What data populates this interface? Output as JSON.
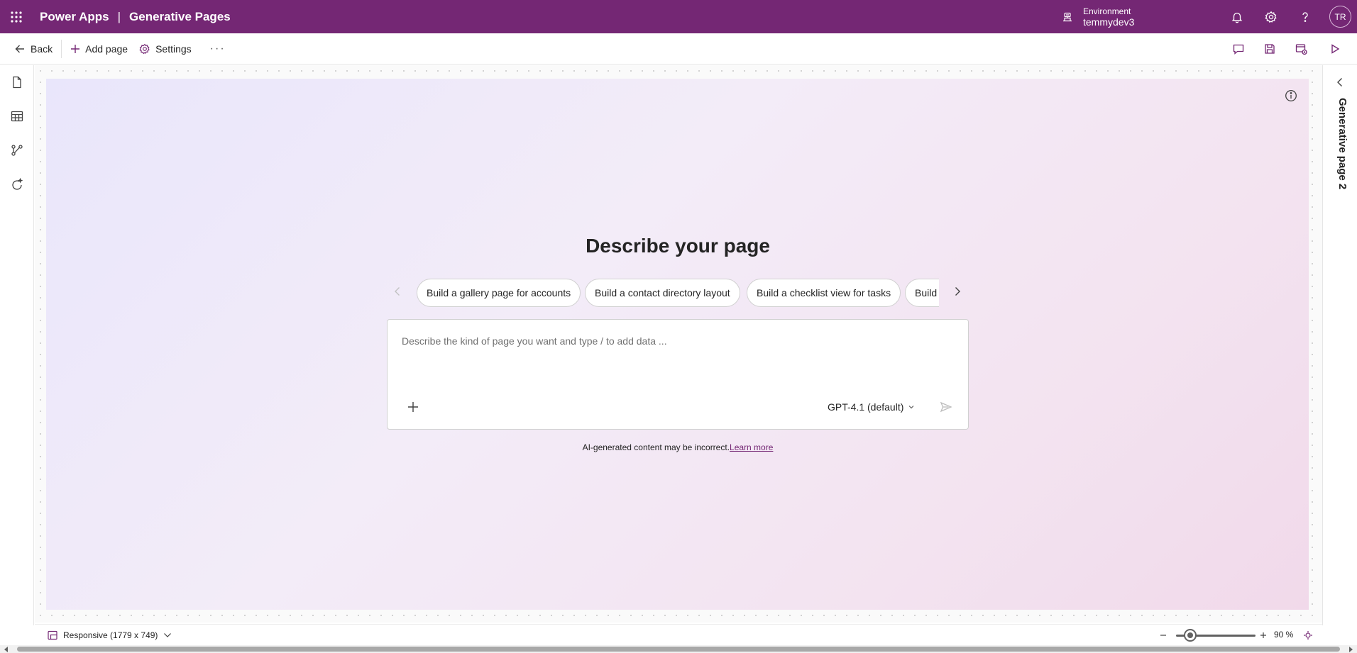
{
  "header": {
    "app_name": "Power Apps",
    "separator": "|",
    "page_name": "Generative Pages",
    "environment_label": "Environment",
    "environment_name": "temmydev3",
    "avatar_initials": "TR"
  },
  "toolbar": {
    "back_label": "Back",
    "add_page_label": "Add page",
    "settings_label": "Settings",
    "more_label": "···"
  },
  "main": {
    "heading": "Describe your page",
    "suggestions": [
      "Build a gallery page for accounts",
      "Build a contact directory layout",
      "Build a checklist view for tasks",
      "Build a"
    ],
    "prompt_placeholder": "Describe the kind of page you want and type / to add data ...",
    "model": "GPT-4.1 (default)",
    "disclaimer": "AI-generated content may be incorrect.",
    "learn_more": "Learn more"
  },
  "right_pane": {
    "title": "Generative page 2"
  },
  "status_bar": {
    "screen_size": "Responsive (1779 x 749)",
    "zoom": "90 %",
    "zoom_level": 0.12
  },
  "icons": {
    "waffle": "app-launcher-icon",
    "environment": "environment-icon",
    "notifications": "bell-icon",
    "settings": "gear-icon",
    "help": "question-icon",
    "back": "arrow-left-icon",
    "add": "plus-icon",
    "comments": "comment-icon",
    "save": "save-icon",
    "publish": "publish-icon",
    "preview": "play-icon",
    "pages": "page-icon",
    "data": "table-icon",
    "flows": "flow-icon",
    "copilot": "sparkle-refresh-icon"
  },
  "colors": {
    "brand": "#742774",
    "canvas_gradient_start": "#e9e6fb",
    "canvas_gradient_end": "#f1d9ea"
  }
}
